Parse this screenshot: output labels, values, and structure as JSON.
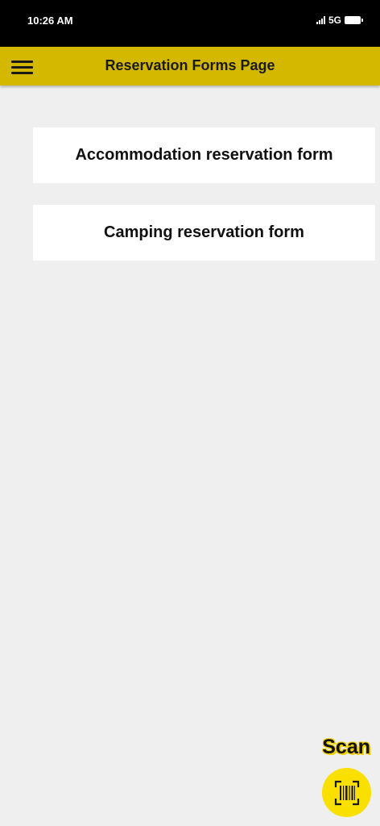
{
  "status_bar": {
    "time": "10:26 AM",
    "network": "5G",
    "icons": [
      "signal-icon",
      "battery-icon"
    ]
  },
  "header": {
    "title": "Reservation Forms Page",
    "menu_icon": "hamburger-menu-icon",
    "background_color": "#d4b800"
  },
  "forms": [
    {
      "label": "Accommodation reservation form"
    },
    {
      "label": "Camping reservation form"
    }
  ],
  "scan": {
    "label": "Scan",
    "icon": "barcode-scan-icon",
    "button_color": "#f9e000"
  }
}
